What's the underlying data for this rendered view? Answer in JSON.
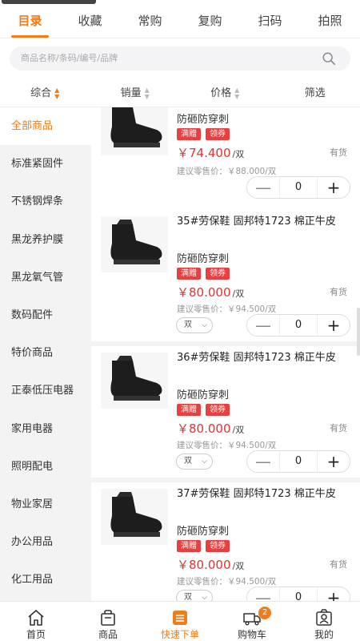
{
  "top_tabs": [
    "目录",
    "收藏",
    "常购",
    "复购",
    "扫码",
    "拍照"
  ],
  "search": {
    "placeholder": "商品名称/条码/编号/品牌"
  },
  "sort": [
    "综合",
    "销量",
    "价格",
    "筛选"
  ],
  "sidebar": [
    "全部商品",
    "标准紧固件",
    "不锈钢焊条",
    "黑龙养护膜",
    "黑龙氧气管",
    "数码配件",
    "特价商品",
    "正泰低压电器",
    "家用电器",
    "照明配电",
    "物业家居",
    "办公用品",
    "化工用品"
  ],
  "products": [
    {
      "name": "",
      "feature": "防砸防穿刺",
      "tags": [
        "满赠",
        "领券"
      ],
      "price": "￥74.400",
      "unit": "/双",
      "stock": "有货",
      "suggest": "建议零售价：￥88.000/双",
      "unit_select": "",
      "qty": "0"
    },
    {
      "name": "35#劳保鞋 固邦特1723 棉正牛皮",
      "feature": "防砸防穿刺",
      "tags": [
        "满赠",
        "领券"
      ],
      "price": "￥80.000",
      "unit": "/双",
      "stock": "有货",
      "suggest": "建议零售价：￥94.500/双",
      "unit_select": "双",
      "qty": "0"
    },
    {
      "name": "36#劳保鞋 固邦特1723 棉正牛皮",
      "feature": "防砸防穿刺",
      "tags": [
        "满赠",
        "领券"
      ],
      "price": "￥80.000",
      "unit": "/双",
      "stock": "有货",
      "suggest": "建议零售价：￥94.500/双",
      "unit_select": "双",
      "qty": "0"
    },
    {
      "name": "37#劳保鞋 固邦特1723 棉正牛皮",
      "feature": "防砸防穿刺",
      "tags": [
        "满赠",
        "领券"
      ],
      "price": "￥80.000",
      "unit": "/双",
      "stock": "有货",
      "suggest": "建议零售价：￥94.500/双",
      "unit_select": "双",
      "qty": "0"
    }
  ],
  "bottom_tabs": [
    "首页",
    "商品",
    "快速下单",
    "购物车",
    "我的"
  ],
  "cart_badge": "2",
  "colors": {
    "accent": "#f07d1a",
    "price": "#e83030",
    "tag": "#e84040"
  }
}
